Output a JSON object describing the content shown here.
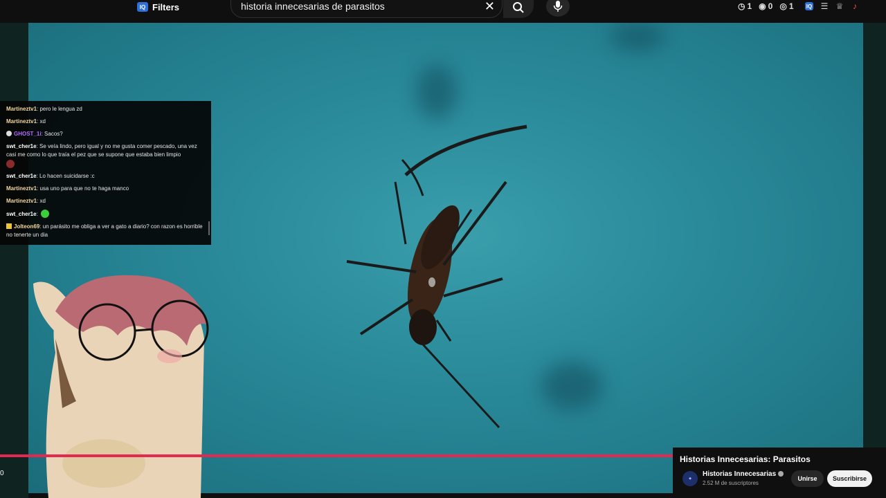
{
  "header": {
    "filters_label": "Filters",
    "filters_badge": "IQ",
    "search_query": "historia innecesarias de parasitos",
    "stats": [
      {
        "icon": "clock-icon",
        "value": "1"
      },
      {
        "icon": "eye-slash-icon",
        "value": "0"
      },
      {
        "icon": "eye-icon",
        "value": "1"
      }
    ],
    "right_icons": [
      "iq-extension-icon",
      "menu-lines-icon",
      "trophy-icon",
      "bell-icon"
    ]
  },
  "chat": {
    "messages": [
      {
        "user": "Martineztv1",
        "text": "pero le lengua zd"
      },
      {
        "user": "Martineztv1",
        "text": "xd"
      },
      {
        "user": "GHOST_1i",
        "text": "Sacos?"
      },
      {
        "user": "swt_cher1e",
        "text": "Se veía lindo, pero igual y no me gusta comer pescado, una vez casi me como lo que traía el pez que se supone que estaba bien limpio"
      },
      {
        "user": "swt_cher1e",
        "text": "Lo hacen suicidarse :c"
      },
      {
        "user": "Martineztv1",
        "text": "usa uno para que no te haga manco"
      },
      {
        "user": "Martineztv1",
        "text": "xd"
      },
      {
        "user": "swt_cher1e",
        "text": ""
      },
      {
        "user": "Jolteon69",
        "text": "un parásito me obliga a ver a gato a diario? con razon es horrible no tenerte un dia"
      }
    ]
  },
  "player": {
    "progress_fraction": 0.76,
    "time_marker": "0"
  },
  "channel": {
    "video_title": "Historias Innecesarias: Parasitos",
    "name": "Historias Innecesarias",
    "subscribers": "2.52 M de suscriptores",
    "join_label": "Unirse",
    "subscribe_label": "Suscribirse"
  }
}
